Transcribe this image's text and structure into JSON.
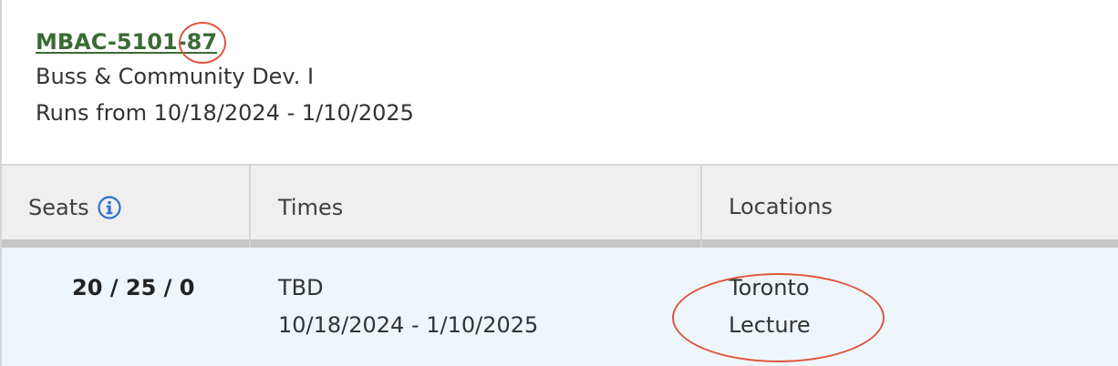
{
  "course": {
    "code": "MBAC-5101-87",
    "title": "Buss & Community Dev. I",
    "runs": "Runs from 10/18/2024 - 1/10/2025"
  },
  "table": {
    "headers": {
      "seats": "Seats",
      "times": "Times",
      "locations": "Locations"
    },
    "rows": [
      {
        "seats": "20 / 25 / 0",
        "times": [
          "TBD",
          "10/18/2024 - 1/10/2025"
        ],
        "locations": [
          "Toronto",
          "Lecture"
        ]
      }
    ]
  },
  "icons": {
    "seats_info": "info-icon"
  },
  "colors": {
    "link": "#3a6b35",
    "info_icon": "#2f6fd0",
    "annotation": "#e0553d",
    "header_bg": "#efefef",
    "row_bg": "#eef6fb"
  }
}
